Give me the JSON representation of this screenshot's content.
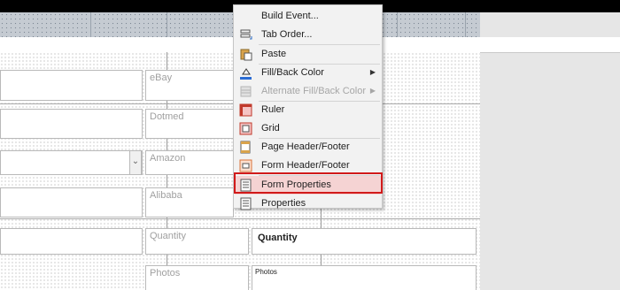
{
  "labels": {
    "ebay": "eBay",
    "dotmed": "Dotmed",
    "amazon": "Amazon",
    "alibaba": "Alibaba",
    "quantity": "Quantity",
    "photos": "Photos"
  },
  "fields": {
    "quantity_value": "Quantity",
    "photos_value": "Photos",
    "combo_arrow": "⌄"
  },
  "context_menu": {
    "items": [
      {
        "label": "Build Event...",
        "icon": "build-event-icon",
        "enabled": true,
        "submenu": false
      },
      {
        "label": "Tab Order...",
        "icon": "tab-order-icon",
        "enabled": true,
        "submenu": false
      },
      {
        "label": "Paste",
        "icon": "paste-icon",
        "enabled": true,
        "submenu": false
      },
      {
        "label": "Fill/Back Color",
        "icon": "fill-color-icon",
        "enabled": true,
        "submenu": true
      },
      {
        "label": "Alternate Fill/Back Color",
        "icon": "alternate-fill-icon",
        "enabled": false,
        "submenu": true
      },
      {
        "label": "Ruler",
        "icon": "ruler-icon",
        "enabled": true,
        "submenu": false
      },
      {
        "label": "Grid",
        "icon": "grid-icon",
        "enabled": true,
        "submenu": false
      },
      {
        "label": "Page Header/Footer",
        "icon": "page-header-footer-icon",
        "enabled": true,
        "submenu": false
      },
      {
        "label": "Form Header/Footer",
        "icon": "form-header-footer-icon",
        "enabled": true,
        "submenu": false
      },
      {
        "label": "Form Properties",
        "icon": "form-properties-icon",
        "enabled": true,
        "submenu": false,
        "highlighted": true
      },
      {
        "label": "Properties",
        "icon": "properties-icon",
        "enabled": true,
        "submenu": false
      }
    ],
    "submenu_arrow": "▶"
  },
  "colors": {
    "highlight_border": "#d11a1a",
    "highlight_fill": "#f5d3d3",
    "menu_bg": "#f2f2f2"
  }
}
